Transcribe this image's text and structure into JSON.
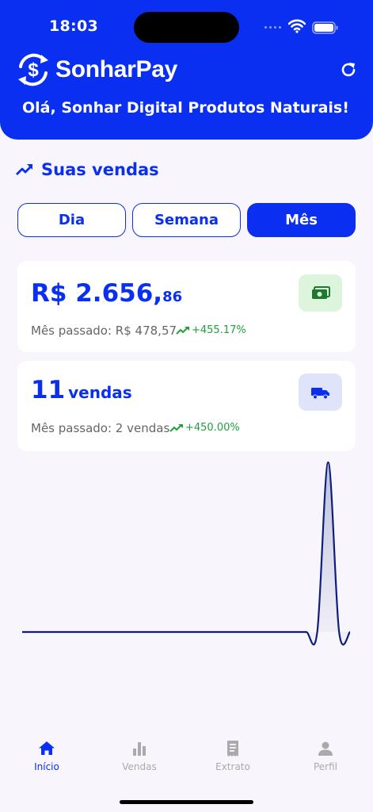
{
  "status_bar": {
    "time": "18:03"
  },
  "header": {
    "brand_name": "SonharPay",
    "greeting": "Olá, Sonhar Digital Produtos Naturais!"
  },
  "section": {
    "title": "Suas vendas"
  },
  "period_tabs": [
    {
      "label": "Dia",
      "active": false
    },
    {
      "label": "Semana",
      "active": false
    },
    {
      "label": "Mês",
      "active": true
    }
  ],
  "revenue_card": {
    "value_main": "R$ 2.656,",
    "value_cents": "86",
    "previous": "Mês passado: R$ 478,57",
    "growth": "+455.17%",
    "icon": "money-icon"
  },
  "sales_card": {
    "count": "11",
    "unit": "vendas",
    "previous": "Mês passado: 2 vendas",
    "growth": "+450.00%",
    "icon": "truck-icon"
  },
  "chart_data": {
    "type": "area",
    "x": [
      1,
      2,
      3,
      4,
      5,
      6,
      7,
      8,
      9,
      10,
      11,
      12,
      13,
      14,
      15,
      16,
      17,
      18,
      19,
      20,
      21,
      22,
      23,
      24,
      25,
      26,
      27,
      28,
      29,
      30,
      31
    ],
    "values": [
      0,
      0,
      0,
      0,
      0,
      0,
      0,
      0,
      0,
      0,
      0,
      0,
      0,
      0,
      0,
      0,
      0,
      0,
      0,
      0,
      0,
      0,
      0,
      0,
      0,
      0,
      0,
      0,
      11,
      0,
      0
    ],
    "title": "",
    "xlabel": "",
    "ylabel": "",
    "grid": false,
    "line_color": "#0d1f7a"
  },
  "bottom_nav": [
    {
      "label": "Início",
      "icon": "home-icon",
      "active": true
    },
    {
      "label": "Vendas",
      "icon": "bar-chart-icon",
      "active": false
    },
    {
      "label": "Extrato",
      "icon": "receipt-icon",
      "active": false
    },
    {
      "label": "Perfil",
      "icon": "person-icon",
      "active": false
    }
  ],
  "colors": {
    "primary": "#0a2ff0",
    "success": "#1fa03a",
    "background": "#f8f6fc"
  }
}
